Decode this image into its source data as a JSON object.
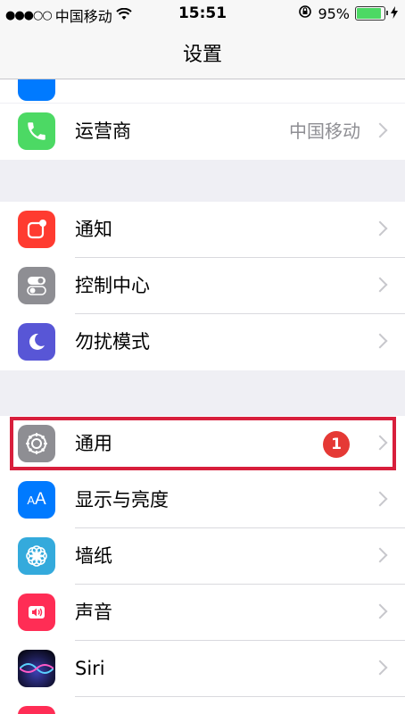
{
  "status_bar": {
    "signal": "●●●○○",
    "carrier": "中国移动",
    "time": "15:51",
    "battery_percent": "95%",
    "battery_level": 0.95
  },
  "nav": {
    "title": "设置"
  },
  "rows": [
    {
      "label": "运营商",
      "value": "中国移动",
      "icon": "phone-icon",
      "color": "#4cd964"
    },
    {
      "label": "通知",
      "icon": "notification-icon",
      "color": "#ff3b30"
    },
    {
      "label": "控制中心",
      "icon": "toggle-icon",
      "color": "#8e8e93"
    },
    {
      "label": "勿扰模式",
      "icon": "moon-icon",
      "color": "#5856d6"
    },
    {
      "label": "通用",
      "icon": "gear-icon",
      "color": "#8e8e93",
      "badge": "1"
    },
    {
      "label": "显示与亮度",
      "icon": "text-size-icon",
      "color": "#007aff"
    },
    {
      "label": "墙纸",
      "icon": "flower-icon",
      "color": "#34aadc"
    },
    {
      "label": "声音",
      "icon": "speaker-icon",
      "color": "#ff2d55"
    },
    {
      "label": "Siri",
      "icon": "siri-icon",
      "color": "#000000"
    }
  ]
}
